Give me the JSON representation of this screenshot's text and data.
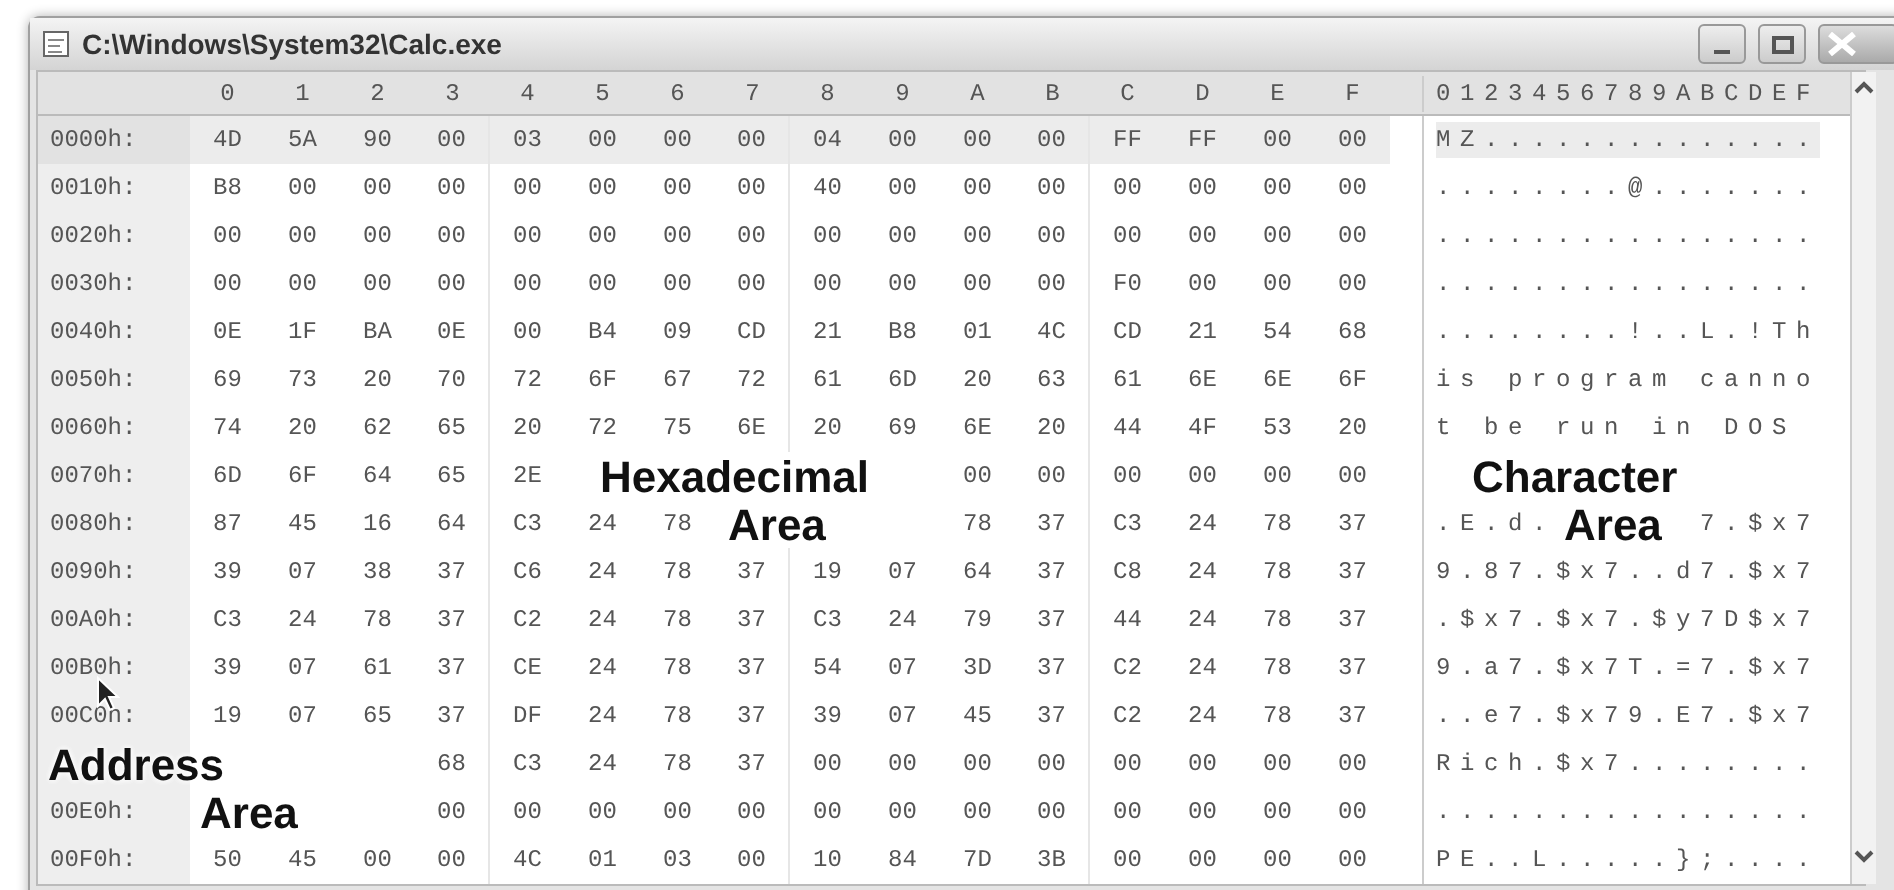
{
  "window": {
    "title": "C:\\Windows\\System32\\Calc.exe"
  },
  "header": {
    "columns": [
      "0",
      "1",
      "2",
      "3",
      "4",
      "5",
      "6",
      "7",
      "8",
      "9",
      "A",
      "B",
      "C",
      "D",
      "E",
      "F"
    ],
    "chars": "0123456789ABCDEF"
  },
  "rows": [
    {
      "address": "0000h:",
      "bytes": [
        "4D",
        "5A",
        "90",
        "00",
        "03",
        "00",
        "00",
        "00",
        "04",
        "00",
        "00",
        "00",
        "FF",
        "FF",
        "00",
        "00"
      ],
      "chars": "MZ..............",
      "selected": true
    },
    {
      "address": "0010h:",
      "bytes": [
        "B8",
        "00",
        "00",
        "00",
        "00",
        "00",
        "00",
        "00",
        "40",
        "00",
        "00",
        "00",
        "00",
        "00",
        "00",
        "00"
      ],
      "chars": "........@.......",
      "selected": false
    },
    {
      "address": "0020h:",
      "bytes": [
        "00",
        "00",
        "00",
        "00",
        "00",
        "00",
        "00",
        "00",
        "00",
        "00",
        "00",
        "00",
        "00",
        "00",
        "00",
        "00"
      ],
      "chars": "................",
      "selected": false
    },
    {
      "address": "0030h:",
      "bytes": [
        "00",
        "00",
        "00",
        "00",
        "00",
        "00",
        "00",
        "00",
        "00",
        "00",
        "00",
        "00",
        "F0",
        "00",
        "00",
        "00"
      ],
      "chars": "................",
      "selected": false
    },
    {
      "address": "0040h:",
      "bytes": [
        "0E",
        "1F",
        "BA",
        "0E",
        "00",
        "B4",
        "09",
        "CD",
        "21",
        "B8",
        "01",
        "4C",
        "CD",
        "21",
        "54",
        "68"
      ],
      "chars": "........!..L.!Th",
      "selected": false
    },
    {
      "address": "0050h:",
      "bytes": [
        "69",
        "73",
        "20",
        "70",
        "72",
        "6F",
        "67",
        "72",
        "61",
        "6D",
        "20",
        "63",
        "61",
        "6E",
        "6E",
        "6F"
      ],
      "chars": "is program canno",
      "selected": false
    },
    {
      "address": "0060h:",
      "bytes": [
        "74",
        "20",
        "62",
        "65",
        "20",
        "72",
        "75",
        "6E",
        "20",
        "69",
        "6E",
        "20",
        "44",
        "4F",
        "53",
        "20"
      ],
      "chars": "t be run in DOS ",
      "selected": false
    },
    {
      "address": "0070h:",
      "bytes": [
        "6D",
        "6F",
        "64",
        "65",
        "2E"
      ],
      "bytes_after": [
        "00",
        "00",
        "00",
        "00",
        "00",
        "00"
      ],
      "selected": false
    },
    {
      "address": "0080h:",
      "bytes": [
        "87",
        "45",
        "16",
        "64",
        "C3",
        "24",
        "78"
      ],
      "bytes_after": [
        "78",
        "37",
        "C3",
        "24",
        "78",
        "37"
      ],
      "chars": ".E.d.",
      "chars_after": "7.$x7",
      "selected": false
    },
    {
      "address": "0090h:",
      "bytes": [
        "39",
        "07",
        "38",
        "37",
        "C6",
        "24",
        "78",
        "37",
        "19",
        "07",
        "64",
        "37",
        "C8",
        "24",
        "78",
        "37"
      ],
      "chars": "9.87.$x7..d7.$x7",
      "selected": false
    },
    {
      "address": "00A0h:",
      "bytes": [
        "C3",
        "24",
        "78",
        "37",
        "C2",
        "24",
        "78",
        "37",
        "C3",
        "24",
        "79",
        "37",
        "44",
        "24",
        "78",
        "37"
      ],
      "chars": ".$x7.$x7.$y7D$x7",
      "selected": false
    },
    {
      "address": "00B0h:",
      "bytes": [
        "39",
        "07",
        "61",
        "37",
        "CE",
        "24",
        "78",
        "37",
        "54",
        "07",
        "3D",
        "37",
        "C2",
        "24",
        "78",
        "37"
      ],
      "chars": "9.a7.$x7T.=7.$x7",
      "selected": false
    },
    {
      "address": "00C0h:",
      "bytes": [
        "19",
        "07",
        "65",
        "37",
        "DF",
        "24",
        "78",
        "37",
        "39",
        "07",
        "45",
        "37",
        "C2",
        "24",
        "78",
        "37"
      ],
      "chars": "..e7.$x79.E7.$x7",
      "selected": false
    },
    {
      "bytes_after": [
        "68",
        "C3",
        "24",
        "78",
        "37",
        "00",
        "00",
        "00",
        "00",
        "00",
        "00",
        "00",
        "00"
      ],
      "chars": "Rich.$x7........",
      "selected": false
    },
    {
      "address": "00E0h:",
      "bytes_after": [
        "00",
        "00",
        "00",
        "00",
        "00",
        "00",
        "00",
        "00",
        "00",
        "00",
        "00",
        "00",
        "00"
      ],
      "chars": "................",
      "selected": false
    },
    {
      "address": "00F0h:",
      "bytes": [
        "50",
        "45",
        "00",
        "00",
        "4C",
        "01",
        "03",
        "00",
        "10",
        "84",
        "7D",
        "3B",
        "00",
        "00",
        "00",
        "00"
      ],
      "chars": "PE..L.....};....",
      "selected": false
    }
  ],
  "annotations": [
    {
      "lines": [
        "Hexadecimal",
        "Area"
      ]
    },
    {
      "lines": [
        "Character",
        "Area"
      ]
    },
    {
      "lines": [
        "Address",
        "Area"
      ]
    }
  ]
}
